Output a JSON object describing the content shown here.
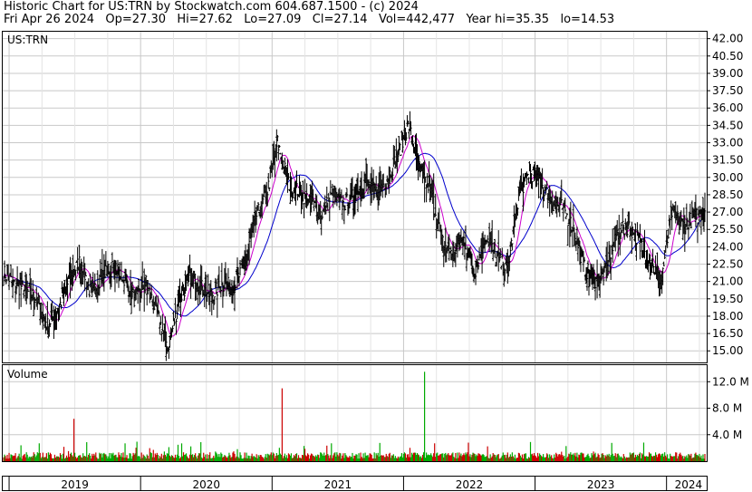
{
  "header": {
    "line1": "Historic Chart for US:TRN by Stockwatch.com 604.687.1500 - (c) 2024",
    "line2": "Fri Apr 26 2024   Op=27.30   Hi=27.62   Lo=27.09   Cl=27.14   Vol=442,477   Year hi=35.35   lo=14.53"
  },
  "colors": {
    "price_bars": "#000000",
    "ma_short": "#cc00cc",
    "ma_long": "#0000cc",
    "volume_up": "#00aa00",
    "volume_down": "#cc0000",
    "grid": "#c8c8c8"
  },
  "chart_data": [
    {
      "type": "ohlc",
      "symbol_label": "US:TRN",
      "price_axis_ticks": [
        "42.00",
        "40.50",
        "39.00",
        "37.50",
        "36.00",
        "34.50",
        "33.00",
        "31.50",
        "30.00",
        "28.50",
        "27.00",
        "25.50",
        "24.00",
        "22.50",
        "21.00",
        "19.50",
        "18.00",
        "16.50",
        "15.00"
      ],
      "ylim": [
        14.0,
        42.6
      ],
      "x_axis_labels": [
        "2019",
        "2020",
        "2021",
        "2022",
        "2023",
        "2024"
      ],
      "grid": true,
      "overlays": [
        "moving-average-short (magenta)",
        "moving-average-long (blue)"
      ],
      "series": [
        {
          "x": [
            "2018-12",
            "2019-01",
            "2019-02",
            "2019-03",
            "2019-04",
            "2019-05",
            "2019-06",
            "2019-07",
            "2019-08",
            "2019-09",
            "2019-10",
            "2019-11",
            "2019-12",
            "2020-01",
            "2020-02",
            "2020-03",
            "2020-04",
            "2020-05",
            "2020-06",
            "2020-07",
            "2020-08",
            "2020-09",
            "2020-10",
            "2020-11",
            "2020-12",
            "2021-01",
            "2021-02",
            "2021-03",
            "2021-04",
            "2021-05",
            "2021-06",
            "2021-07",
            "2021-08",
            "2021-09",
            "2021-10",
            "2021-11",
            "2021-12",
            "2022-01",
            "2022-02",
            "2022-03",
            "2022-04",
            "2022-05",
            "2022-06",
            "2022-07",
            "2022-08",
            "2022-09",
            "2022-10",
            "2022-11",
            "2022-12",
            "2023-01",
            "2023-02",
            "2023-03",
            "2023-04",
            "2023-05",
            "2023-06",
            "2023-07",
            "2023-08",
            "2023-09",
            "2023-10",
            "2023-11",
            "2023-12",
            "2024-01",
            "2024-02",
            "2024-03",
            "2024-04"
          ],
          "close": [
            21.8,
            20.7,
            20.2,
            19.6,
            17.2,
            18.6,
            21.2,
            22.8,
            19.8,
            21.6,
            22.2,
            21.3,
            19.4,
            20.9,
            18.2,
            15.3,
            19.2,
            21.5,
            20.5,
            19.8,
            20.8,
            20.5,
            22.5,
            26.5,
            28.5,
            33.0,
            29.5,
            28.7,
            28.0,
            26.8,
            28.5,
            27.6,
            28.4,
            29.6,
            28.7,
            29.8,
            32.0,
            34.5,
            30.5,
            29.0,
            24.5,
            23.5,
            24.7,
            21.8,
            25.1,
            23.0,
            22.0,
            28.5,
            30.5,
            29.7,
            27.8,
            27.4,
            25.6,
            22.2,
            21.0,
            21.8,
            25.2,
            25.8,
            24.6,
            22.7,
            21.0,
            27.0,
            25.9,
            26.5,
            27.1
          ]
        }
      ]
    },
    {
      "type": "bar",
      "title": "Volume",
      "volume_axis_ticks": [
        "12.0 M",
        "8.0 M",
        "4.0 M"
      ],
      "ylim_millions": [
        0,
        14.5
      ],
      "typical_volume_millions": 0.9,
      "spikes": [
        {
          "date": "2019-06",
          "volume_millions": 6.4,
          "direction": "down"
        },
        {
          "date": "2021-01",
          "volume_millions": 11.0,
          "direction": "down"
        },
        {
          "date": "2022-02",
          "volume_millions": 13.5,
          "direction": "up"
        },
        {
          "date": "2022-06",
          "volume_millions": 2.8,
          "direction": "down"
        }
      ]
    }
  ]
}
